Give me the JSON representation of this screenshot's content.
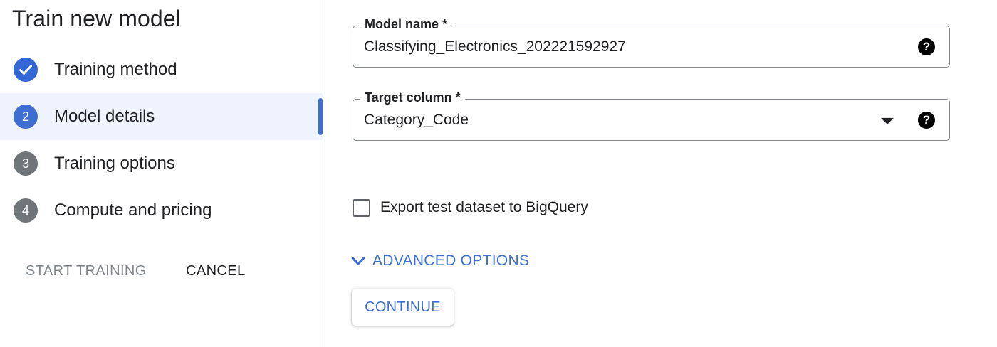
{
  "panel": {
    "title": "Train new model",
    "steps": [
      {
        "number": "",
        "label": "Training method",
        "state": "completed",
        "icon": "check-icon"
      },
      {
        "number": "2",
        "label": "Model details",
        "state": "active"
      },
      {
        "number": "3",
        "label": "Training options",
        "state": "pending"
      },
      {
        "number": "4",
        "label": "Compute and pricing",
        "state": "pending"
      }
    ],
    "start_training_label": "START TRAINING",
    "cancel_label": "CANCEL"
  },
  "form": {
    "model_name": {
      "label": "Model name *",
      "value": "Classifying_Electronics_202221592927",
      "help_icon": "?"
    },
    "target_column": {
      "label": "Target column *",
      "value": "Category_Code",
      "help_icon": "?"
    },
    "export_checkbox": {
      "label": "Export test dataset to BigQuery",
      "checked": false
    },
    "advanced_options_label": "ADVANCED OPTIONS",
    "continue_label": "CONTINUE"
  },
  "colors": {
    "accent": "#3c6fd1",
    "active_bg": "#eef3fd",
    "pending_step": "#70757a",
    "disabled_text": "#80868b"
  }
}
